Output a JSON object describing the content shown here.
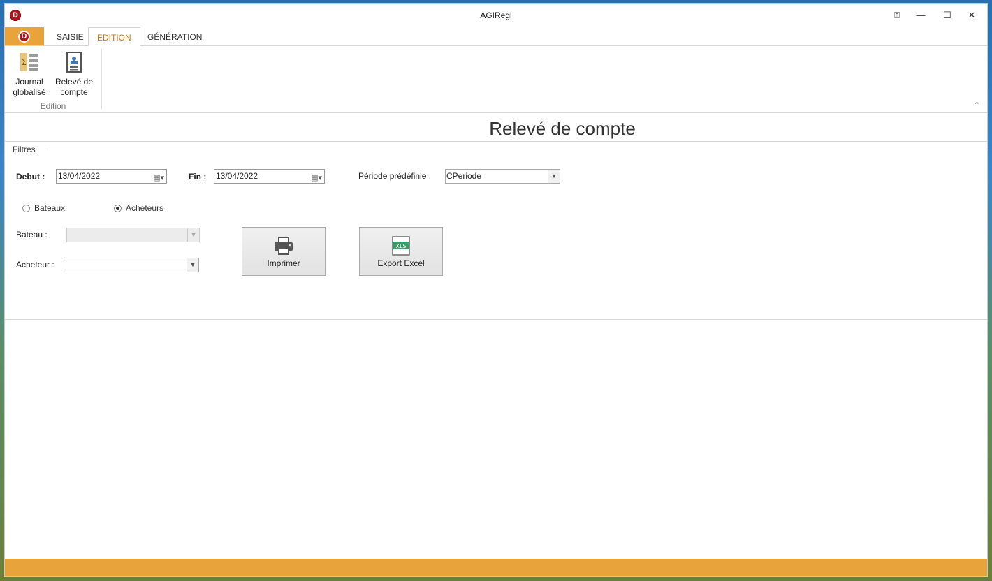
{
  "window": {
    "title": "AGIRegl",
    "app_logo_letter": "D",
    "controls": {
      "pin": "⍐",
      "minimize": "—",
      "maximize": "☐",
      "close": "✕"
    }
  },
  "tabs": {
    "file_logo_letter": "D",
    "items": [
      {
        "label": "SAISIE"
      },
      {
        "label": "EDITION"
      },
      {
        "label": "GÉNÉRATION"
      }
    ],
    "active": "EDITION"
  },
  "ribbon": {
    "buttons": [
      {
        "label_line1": "Journal",
        "label_line2": "globalisé",
        "icon": "journal-icon"
      },
      {
        "label_line1": "Relevé de",
        "label_line2": "compte",
        "icon": "statement-icon"
      }
    ],
    "group_label": "Edition",
    "collapse_glyph": "⌃"
  },
  "page": {
    "title": "Relevé de compte"
  },
  "filters": {
    "legend": "Filtres",
    "debut_label": "Debut :",
    "debut_value": "13/04/2022",
    "fin_label": "Fin :",
    "fin_value": "13/04/2022",
    "periode_label": "Période prédéfinie :",
    "periode_value": "CPeriode",
    "radio_bateaux": "Bateaux",
    "radio_acheteurs": "Acheteurs",
    "selected_radio": "Acheteurs",
    "bateau_label": "Bateau :",
    "bateau_value": "",
    "acheteur_label": "Acheteur :",
    "acheteur_value": ""
  },
  "actions": {
    "print_label": "Imprimer",
    "excel_label": "Export Excel",
    "excel_icon_text": "XLS"
  },
  "colors": {
    "accent": "#e8a33a",
    "active_tab": "#c77b15",
    "logo_red": "#b5121b"
  }
}
